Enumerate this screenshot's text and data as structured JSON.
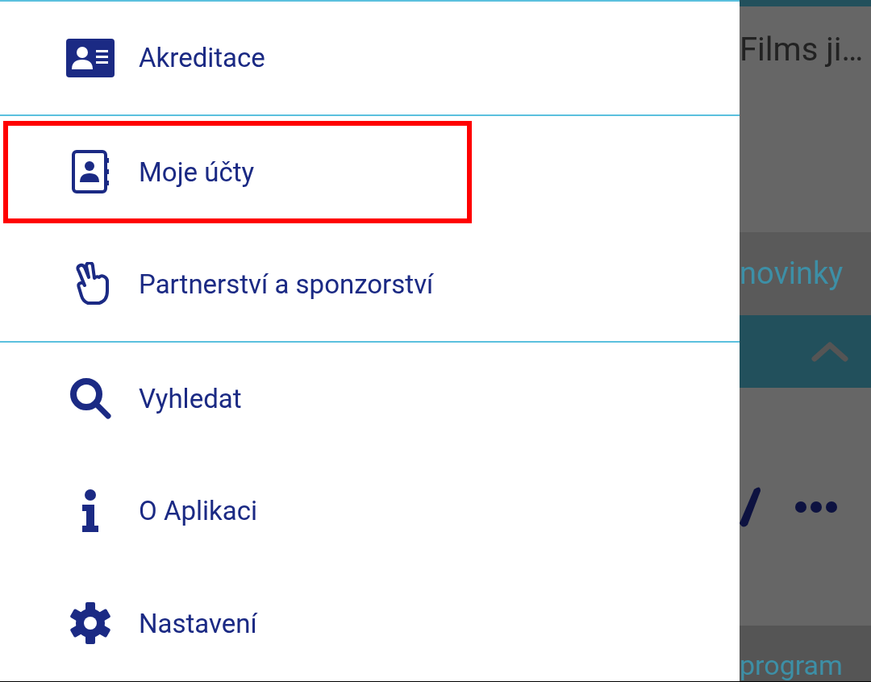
{
  "drawer": {
    "items": [
      {
        "label": "Akreditace",
        "highlighted": false,
        "divider_after": true
      },
      {
        "label": "Moje účty",
        "highlighted": true,
        "divider_after": false
      },
      {
        "label": "Partnerství a sponzorství",
        "highlighted": false,
        "divider_after": true
      },
      {
        "label": "Vyhledat",
        "highlighted": false,
        "divider_after": false
      },
      {
        "label": "O Aplikaci",
        "highlighted": false,
        "divider_after": false
      },
      {
        "label": "Nastavení",
        "highlighted": false,
        "divider_after": false
      }
    ]
  },
  "background": {
    "title": "Films ji…",
    "tab": "novinky",
    "bottom_tab": "program"
  }
}
